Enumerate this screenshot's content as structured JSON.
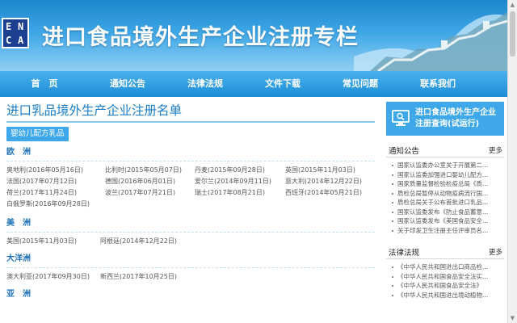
{
  "banner": {
    "logo_letters": [
      "E",
      "N",
      "C",
      "A"
    ],
    "title": "进口食品境外生产企业注册专栏"
  },
  "nav": {
    "items": [
      "首　页",
      "通知公告",
      "法律法规",
      "文件下载",
      "常见问题",
      "联系我们"
    ]
  },
  "main": {
    "title": "进口乳品境外生产企业注册名单",
    "filter_label": "婴幼儿配方乳品",
    "regions": [
      {
        "name": "欧　洲",
        "countries": [
          "奥地利(2016年05月16日)",
          "比利时(2015年05月07日)",
          "丹麦(2015年09月28日)",
          "英国(2015年11月03日)",
          "法国(2017年07月12日)",
          "德国(2016年06月01日)",
          "爱尔兰(2014年09月11日)",
          "意大利(2014年12月22日)",
          "荷兰(2017年11月24日)",
          "波兰(2017年07月21日)",
          "瑞士(2017年08月21日)",
          "西班牙(2014年05月21日)",
          "白俄罗斯(2016年09月28日)"
        ]
      },
      {
        "name": "美　洲",
        "countries": [
          "美国(2015年11月03日)",
          "阿根廷(2014年12月22日)"
        ]
      },
      {
        "name": "大洋洲",
        "countries": [
          "澳大利亚(2017年09月30日)",
          "新西兰(2017年10月25日)"
        ]
      },
      {
        "name": "亚　洲",
        "countries": []
      }
    ]
  },
  "side": {
    "query_label": "进口食品境外生产企业注册查询(试运行)",
    "notices": {
      "heading": "通知公告",
      "more": "更多",
      "items": [
        "国家认监委办公室关于开展第二...",
        "国家认监委加强进口婴幼儿配方...",
        "国家质量监督检验检疫总局《质...",
        "质检总局暂停从动物疫病流行国...",
        "质检总局关于公布首批进口乳品...",
        "国家认监委发布《防止食品蓄意...",
        "国家认监委发布《美国食品安全...",
        "关于印发卫生注册主任评审员名..."
      ]
    },
    "laws": {
      "heading": "法律法规",
      "more": "更多",
      "items": [
        "《中华人民共和国进出口商品检...",
        "《中华人民共和国食品安全法实...",
        "《中华人民共和国食品安全法》",
        "《中华人民共和国进出境动植物..."
      ]
    }
  }
}
